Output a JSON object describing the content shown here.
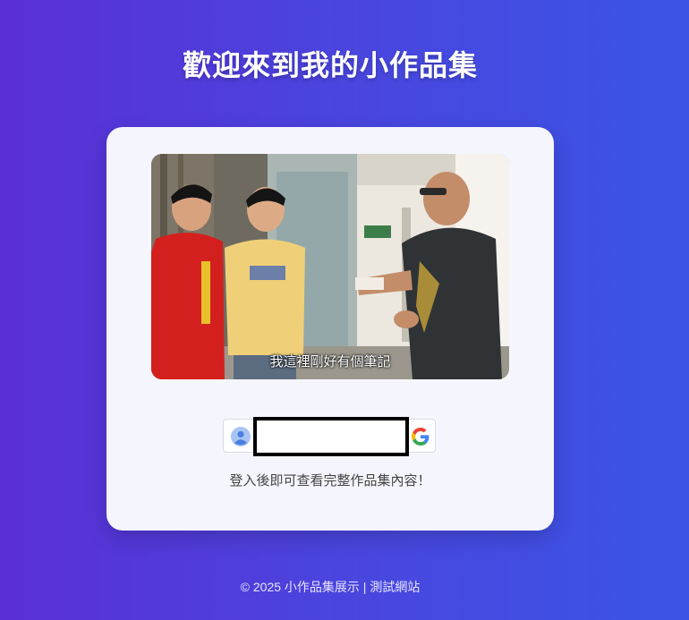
{
  "header": {
    "title": "歡迎來到我的小作品集"
  },
  "card": {
    "image": {
      "subtitle": "我這裡剛好有個筆記"
    },
    "login": {
      "avatar_icon": "user-avatar-icon",
      "provider_icon": "google-icon"
    },
    "hint": "登入後即可查看完整作品集內容！"
  },
  "footer": {
    "text": "© 2025 小作品集展示 | 測試網站"
  },
  "colors": {
    "gradient_start": "#5a2fd6",
    "gradient_end": "#3a55e6",
    "card_bg": "#f5f5fd"
  }
}
